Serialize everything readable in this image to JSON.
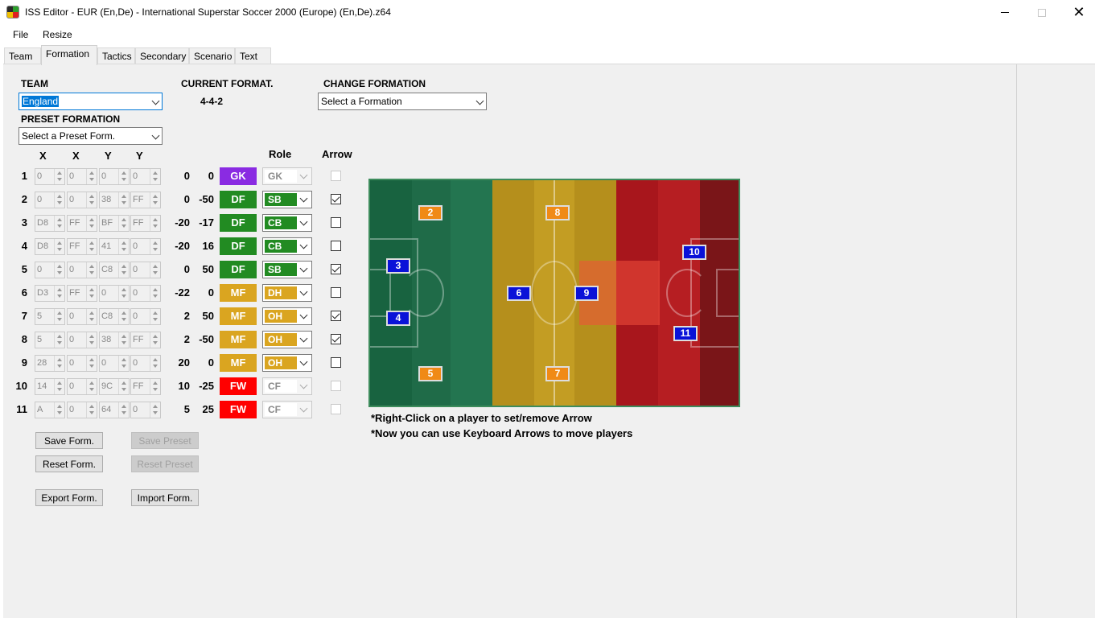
{
  "window": {
    "title": "ISS Editor - EUR (En,De) - International Superstar Soccer 2000 (Europe) (En,De).z64"
  },
  "menu": [
    "File",
    "Resize"
  ],
  "tabs": [
    "Team",
    "Formation",
    "Tactics",
    "Secondary",
    "Scenario",
    "Text"
  ],
  "active_tab": "Formation",
  "labels": {
    "team": "TEAM",
    "current_format": "CURRENT FORMAT.",
    "change_formation": "CHANGE FORMATION",
    "preset_formation": "PRESET FORMATION",
    "col_x1": "X",
    "col_x2": "X",
    "col_y1": "Y",
    "col_y2": "Y",
    "role": "Role",
    "arrow": "Arrow"
  },
  "team_select": "England",
  "current_formation": "4-4-2",
  "change_formation_select": "Select a Formation",
  "preset_select": "Select a Preset Form.",
  "colors": {
    "GK": "#8a2be2",
    "DF": "#228b22",
    "MF": "#daa520",
    "FW": "#ff0000"
  },
  "players": [
    {
      "n": "1",
      "x1": "0",
      "x2": "0",
      "y1": "0",
      "y2": "0",
      "a": "0",
      "b": "0",
      "pos": "GK",
      "role": "GK",
      "arrow": false,
      "enabled": false
    },
    {
      "n": "2",
      "x1": "0",
      "x2": "0",
      "y1": "38",
      "y2": "FF",
      "a": "0",
      "b": "-50",
      "pos": "DF",
      "role": "SB",
      "arrow": true,
      "enabled": true
    },
    {
      "n": "3",
      "x1": "D8",
      "x2": "FF",
      "y1": "BF",
      "y2": "FF",
      "a": "-20",
      "b": "-17",
      "pos": "DF",
      "role": "CB",
      "arrow": false,
      "enabled": true
    },
    {
      "n": "4",
      "x1": "D8",
      "x2": "FF",
      "y1": "41",
      "y2": "0",
      "a": "-20",
      "b": "16",
      "pos": "DF",
      "role": "CB",
      "arrow": false,
      "enabled": true
    },
    {
      "n": "5",
      "x1": "0",
      "x2": "0",
      "y1": "C8",
      "y2": "0",
      "a": "0",
      "b": "50",
      "pos": "DF",
      "role": "SB",
      "arrow": true,
      "enabled": true
    },
    {
      "n": "6",
      "x1": "D3",
      "x2": "FF",
      "y1": "0",
      "y2": "0",
      "a": "-22",
      "b": "0",
      "pos": "MF",
      "role": "DH",
      "arrow": false,
      "enabled": true
    },
    {
      "n": "7",
      "x1": "5",
      "x2": "0",
      "y1": "C8",
      "y2": "0",
      "a": "2",
      "b": "50",
      "pos": "MF",
      "role": "OH",
      "arrow": true,
      "enabled": true
    },
    {
      "n": "8",
      "x1": "5",
      "x2": "0",
      "y1": "38",
      "y2": "FF",
      "a": "2",
      "b": "-50",
      "pos": "MF",
      "role": "OH",
      "arrow": true,
      "enabled": true
    },
    {
      "n": "9",
      "x1": "28",
      "x2": "0",
      "y1": "0",
      "y2": "0",
      "a": "20",
      "b": "0",
      "pos": "MF",
      "role": "OH",
      "arrow": false,
      "enabled": true
    },
    {
      "n": "10",
      "x1": "14",
      "x2": "0",
      "y1": "9C",
      "y2": "FF",
      "a": "10",
      "b": "-25",
      "pos": "FW",
      "role": "CF",
      "arrow": false,
      "enabled": false
    },
    {
      "n": "11",
      "x1": "A",
      "x2": "0",
      "y1": "64",
      "y2": "0",
      "a": "5",
      "b": "25",
      "pos": "FW",
      "role": "CF",
      "arrow": false,
      "enabled": false
    }
  ],
  "buttons": {
    "save_form": "Save Form.",
    "save_preset": "Save Preset",
    "reset_form": "Reset Form.",
    "reset_preset": "Reset Preset",
    "export_form": "Export Form.",
    "import_form": "Import Form."
  },
  "pitch_markers": [
    "2",
    "8",
    "3",
    "10",
    "6",
    "9",
    "4",
    "11",
    "5",
    "7"
  ],
  "notes": [
    "*Right-Click on a player to set/remove Arrow",
    "*Now you can use Keyboard Arrows to move players"
  ]
}
